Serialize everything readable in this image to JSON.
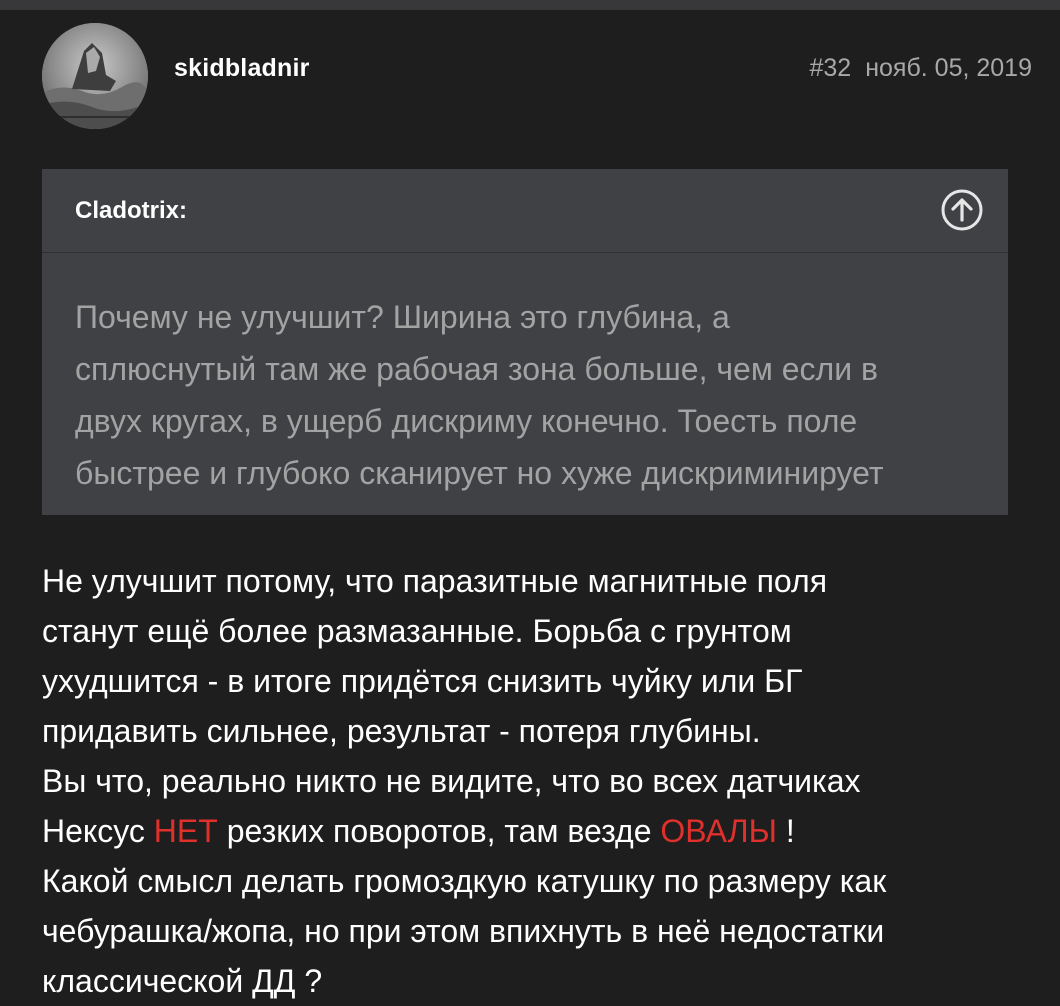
{
  "post": {
    "author": "skidbladnir",
    "number": "#32",
    "date": "нояб. 05, 2019",
    "quote": {
      "author": "Cladotrix:",
      "icon": "arrow-up-circle-icon",
      "lines": [
        "Почему не улучшит? Ширина это глубина, а",
        "сплюснутый там же рабочая зона больше, чем если в",
        "двух кругах, в ущерб дискриму конечно. Тоесть поле",
        "быстрее и глубоко сканирует но хуже дискриминирует"
      ]
    },
    "body": {
      "lines": [
        "Не улучшит потому, что паразитные магнитные поля",
        "станут ещё более размазанные. Борьба с грунтом",
        "ухудшится - в итоге придётся снизить чуйку или БГ",
        "придавить сильнее, результат - потеря глубины.",
        "Вы что, реально никто не видите, что во всех датчиках"
      ],
      "line6_a": "Нексус ",
      "line6_red1": "НЕТ",
      "line6_b": " резких поворотов, там везде ",
      "line6_red2": "ОВАЛЫ",
      "line6_c": " !",
      "lines_after": [
        "Какой смысл делать громоздкую катушку по размеру как",
        "чебурашка/жопа, но при этом впихнуть в неё недостатки",
        "классической ДД ?"
      ]
    }
  },
  "colors": {
    "background": "#1e1e1f",
    "quote_background": "#3f4144",
    "highlight": "#e0302c",
    "meta_text": "#a8a8a8",
    "quote_text": "#a3a3a3"
  }
}
